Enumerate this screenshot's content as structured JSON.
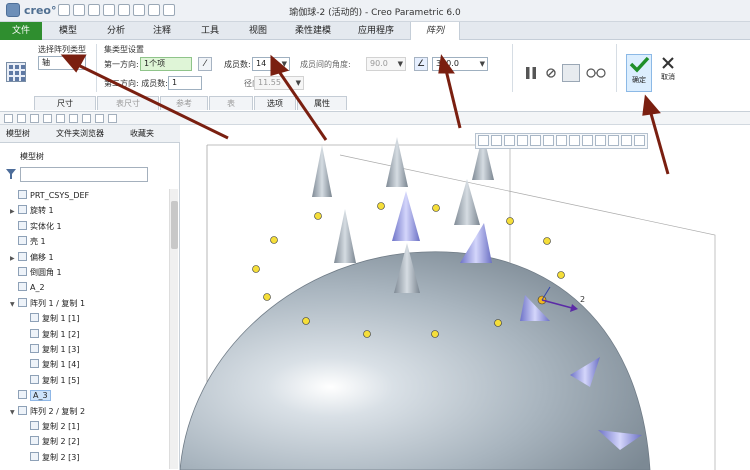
{
  "app": {
    "logo_text": "creo°",
    "window_title": "瑜伽球-2 (活动的) - Creo Parametric 6.0"
  },
  "menu": {
    "tabs": [
      "文件",
      "模型",
      "分析",
      "注释",
      "工具",
      "视图",
      "柔性建模",
      "应用程序",
      "阵列"
    ]
  },
  "ribbon": {
    "pattern_type_label": "选择阵列类型",
    "pattern_type_value": "轴",
    "set_settings_label": "集类型设置",
    "first_direction_label": "第一方向:",
    "first_direction_value": "1个项",
    "member_count_label": "成员数:",
    "member_count_value": "14",
    "member_angle_label": "成员间的角度:",
    "member_angle_value": "90.0",
    "angle_range_value": "360.0",
    "second_direction_label": "第二方向: 成员数:",
    "second_direction_value": "1",
    "radial_distance_label": "径向距离:",
    "radial_distance_value": "11.55",
    "subtabs": [
      "尺寸",
      "表尺寸",
      "参考",
      "表",
      "选项",
      "属性"
    ],
    "confirm_label": "确定",
    "cancel_label": "取消"
  },
  "nav": {
    "tabs": [
      "模型树",
      "文件夹浏览器",
      "收藏夹"
    ],
    "tree_title": "模型树",
    "items": [
      {
        "label": "PRT_CSYS_DEF",
        "indent": 0,
        "arrow": ""
      },
      {
        "label": "旋转 1",
        "indent": 0,
        "arrow": "▶"
      },
      {
        "label": "实体化 1",
        "indent": 0,
        "arrow": ""
      },
      {
        "label": "壳 1",
        "indent": 0,
        "arrow": ""
      },
      {
        "label": "偏移 1",
        "indent": 0,
        "arrow": "▶"
      },
      {
        "label": "倒圆角 1",
        "indent": 0,
        "arrow": ""
      },
      {
        "label": "A_2",
        "indent": 0,
        "arrow": ""
      },
      {
        "label": "阵列 1 / 复制 1",
        "indent": 0,
        "arrow": "▼"
      },
      {
        "label": "复制 1 [1]",
        "indent": 1,
        "arrow": ""
      },
      {
        "label": "复制 1 [2]",
        "indent": 1,
        "arrow": ""
      },
      {
        "label": "复制 1 [3]",
        "indent": 1,
        "arrow": ""
      },
      {
        "label": "复制 1 [4]",
        "indent": 1,
        "arrow": ""
      },
      {
        "label": "复制 1 [5]",
        "indent": 1,
        "arrow": ""
      },
      {
        "label": "A_3",
        "indent": 0,
        "arrow": "",
        "selected": true
      },
      {
        "label": "阵列 2 / 复制 2",
        "indent": 0,
        "arrow": "▼"
      },
      {
        "label": "复制 2 [1]",
        "indent": 1,
        "arrow": ""
      },
      {
        "label": "复制 2 [2]",
        "indent": 1,
        "arrow": ""
      },
      {
        "label": "复制 2 [3]",
        "indent": 1,
        "arrow": ""
      }
    ]
  },
  "viewport": {
    "axis_label": "2"
  },
  "colors": {
    "file_tab": "#2f8e2f",
    "arrow_annotation": "#7a1f10",
    "model_body": "#a7b3bd",
    "pattern_preview": "#9aa0e6",
    "confirm_check": "#1f8f2a"
  }
}
